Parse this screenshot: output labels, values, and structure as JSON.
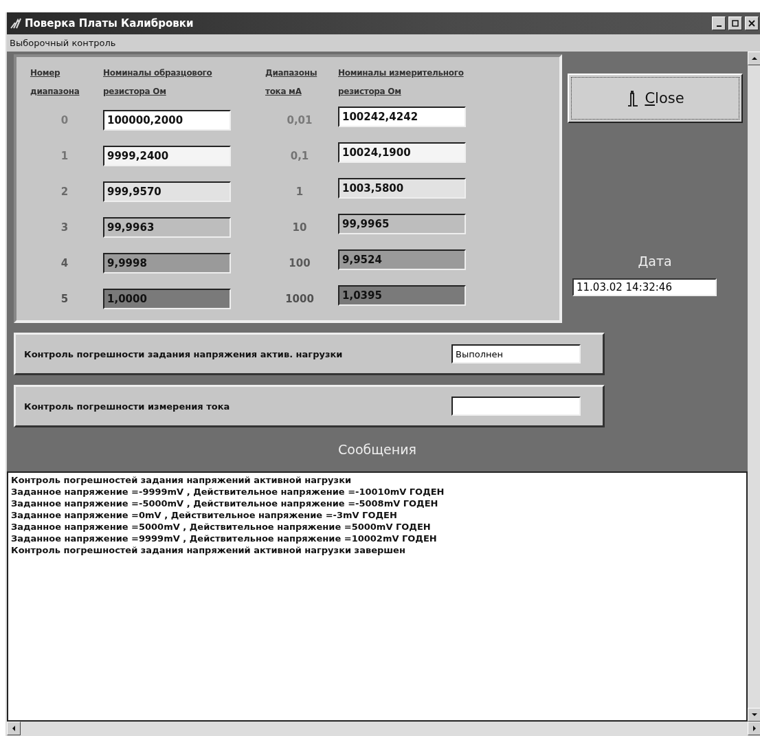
{
  "window": {
    "title": "Поверка Платы Калибровки"
  },
  "menu": [
    "Выборочный контроль"
  ],
  "table": {
    "columns": [
      "Номер диапазона",
      "Номиналы образцового резистора Ом",
      "Диапазоны тока мА",
      "Номиналы измерительного резистора Ом"
    ],
    "rows": [
      {
        "range": "0",
        "reference": "100000,2000",
        "current": "0,01",
        "measuring": "100242,4242",
        "color": "#ffffff"
      },
      {
        "range": "1",
        "reference": "9999,2400",
        "current": "0,1",
        "measuring": "10024,1900",
        "color": "#f4f4f4"
      },
      {
        "range": "2",
        "reference": "999,9570",
        "current": "1",
        "measuring": "1003,5800",
        "color": "#e2e2e2"
      },
      {
        "range": "3",
        "reference": "99,9963",
        "current": "10",
        "measuring": "99,9965",
        "color": "#bdbdbd"
      },
      {
        "range": "4",
        "reference": "9,9998",
        "current": "100",
        "measuring": "9,9524",
        "color": "#9a9a9a"
      },
      {
        "range": "5",
        "reference": "1,0000",
        "current": "1000",
        "measuring": "1,0395",
        "color": "#7a7a7a"
      }
    ]
  },
  "close_button": {
    "label": "Close"
  },
  "date": {
    "label": "Дата",
    "value": "11.03.02 14:32:46"
  },
  "checks": [
    {
      "label": "Контроль погрешности задания напряжения актив. нагрузки",
      "value": "Выполнен"
    },
    {
      "label": "Контроль погрешности измерения тока"
    }
  ],
  "messages": {
    "title": "Сообщения",
    "lines": [
      "Контроль погрешностей задания напряжений активной нагрузки",
      "Заданное напряжение =-9999mV , Действительное напряжение =-10010mV ГОДЕН",
      "Заданное напряжение =-5000mV , Действительное напряжение =-5008mV ГОДЕН",
      "Заданное напряжение =0mV , Действительное напряжение =-3mV ГОДЕН",
      "Заданное напряжение =5000mV , Действительное напряжение =5000mV ГОДЕН",
      "Заданное напряжение =9999mV , Действительное напряжение =10002mV ГОДЕН",
      "Контроль погрешностей задания напряжений активной нагрузки завершен"
    ]
  }
}
